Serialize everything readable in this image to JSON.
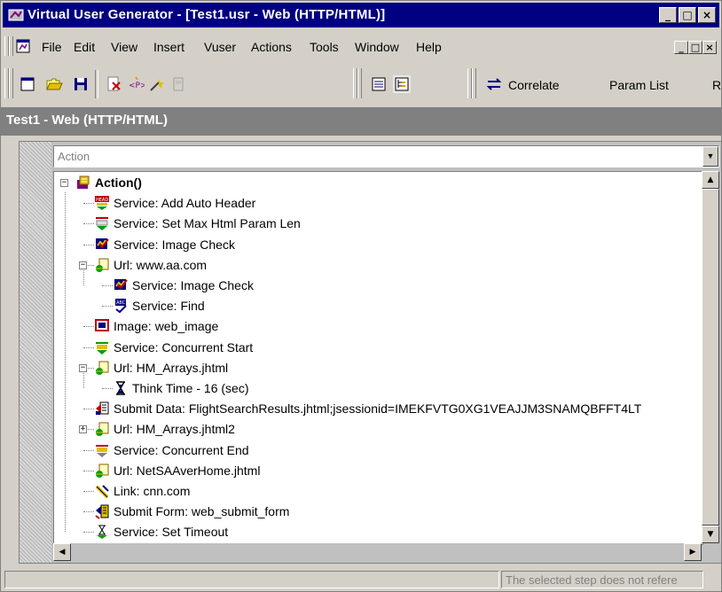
{
  "window": {
    "title": "Virtual User Generator - [Test1.usr - Web (HTTP/HTML)]",
    "min": "_",
    "max": "□",
    "close": "×"
  },
  "menu": {
    "items": [
      "File",
      "Edit",
      "View",
      "Insert",
      "Vuser",
      "Actions",
      "Tools",
      "Window",
      "Help"
    ]
  },
  "toolbar": {
    "correlate_label": "Correlate",
    "param_list_label": "Param List",
    "r_label": "R"
  },
  "document": {
    "title": "Test1 - Web (HTTP/HTML)"
  },
  "combo": {
    "value": "Action"
  },
  "tree": {
    "nodes": [
      {
        "label": "Action()",
        "icon": "action-icon"
      },
      {
        "label": "Service: Add Auto Header",
        "icon": "header-service-icon"
      },
      {
        "label": "Service: Set Max Html Param Len",
        "icon": "service-icon"
      },
      {
        "label": "Service: Image Check",
        "icon": "image-check-icon"
      },
      {
        "label": "Url: www.aa.com",
        "icon": "url-icon"
      },
      {
        "label": "Service: Image Check",
        "icon": "image-check-icon"
      },
      {
        "label": "Service: Find",
        "icon": "find-icon"
      },
      {
        "label": "Image: web_image",
        "icon": "image-icon"
      },
      {
        "label": "Service: Concurrent Start",
        "icon": "concurrent-start-icon"
      },
      {
        "label": "Url: HM_Arrays.jhtml",
        "icon": "url-icon"
      },
      {
        "label": "Think Time - 16 (sec)",
        "icon": "hourglass-icon"
      },
      {
        "label": "Submit Data: FlightSearchResults.jhtml;jsessionid=IMEKFVTG0XG1VEAJJM3SNAMQBFFT4LT",
        "icon": "submit-data-icon"
      },
      {
        "label": "Url: HM_Arrays.jhtml2",
        "icon": "url-icon"
      },
      {
        "label": "Service: Concurrent End",
        "icon": "concurrent-end-icon"
      },
      {
        "label": "Url: NetSAAverHome.jhtml",
        "icon": "url-icon"
      },
      {
        "label": "Link: cnn.com",
        "icon": "link-icon"
      },
      {
        "label": "Submit Form: web_submit_form",
        "icon": "submit-form-icon"
      },
      {
        "label": "Service: Set Timeout",
        "icon": "timeout-icon"
      }
    ]
  },
  "status": {
    "message": "The selected step does not refere"
  }
}
